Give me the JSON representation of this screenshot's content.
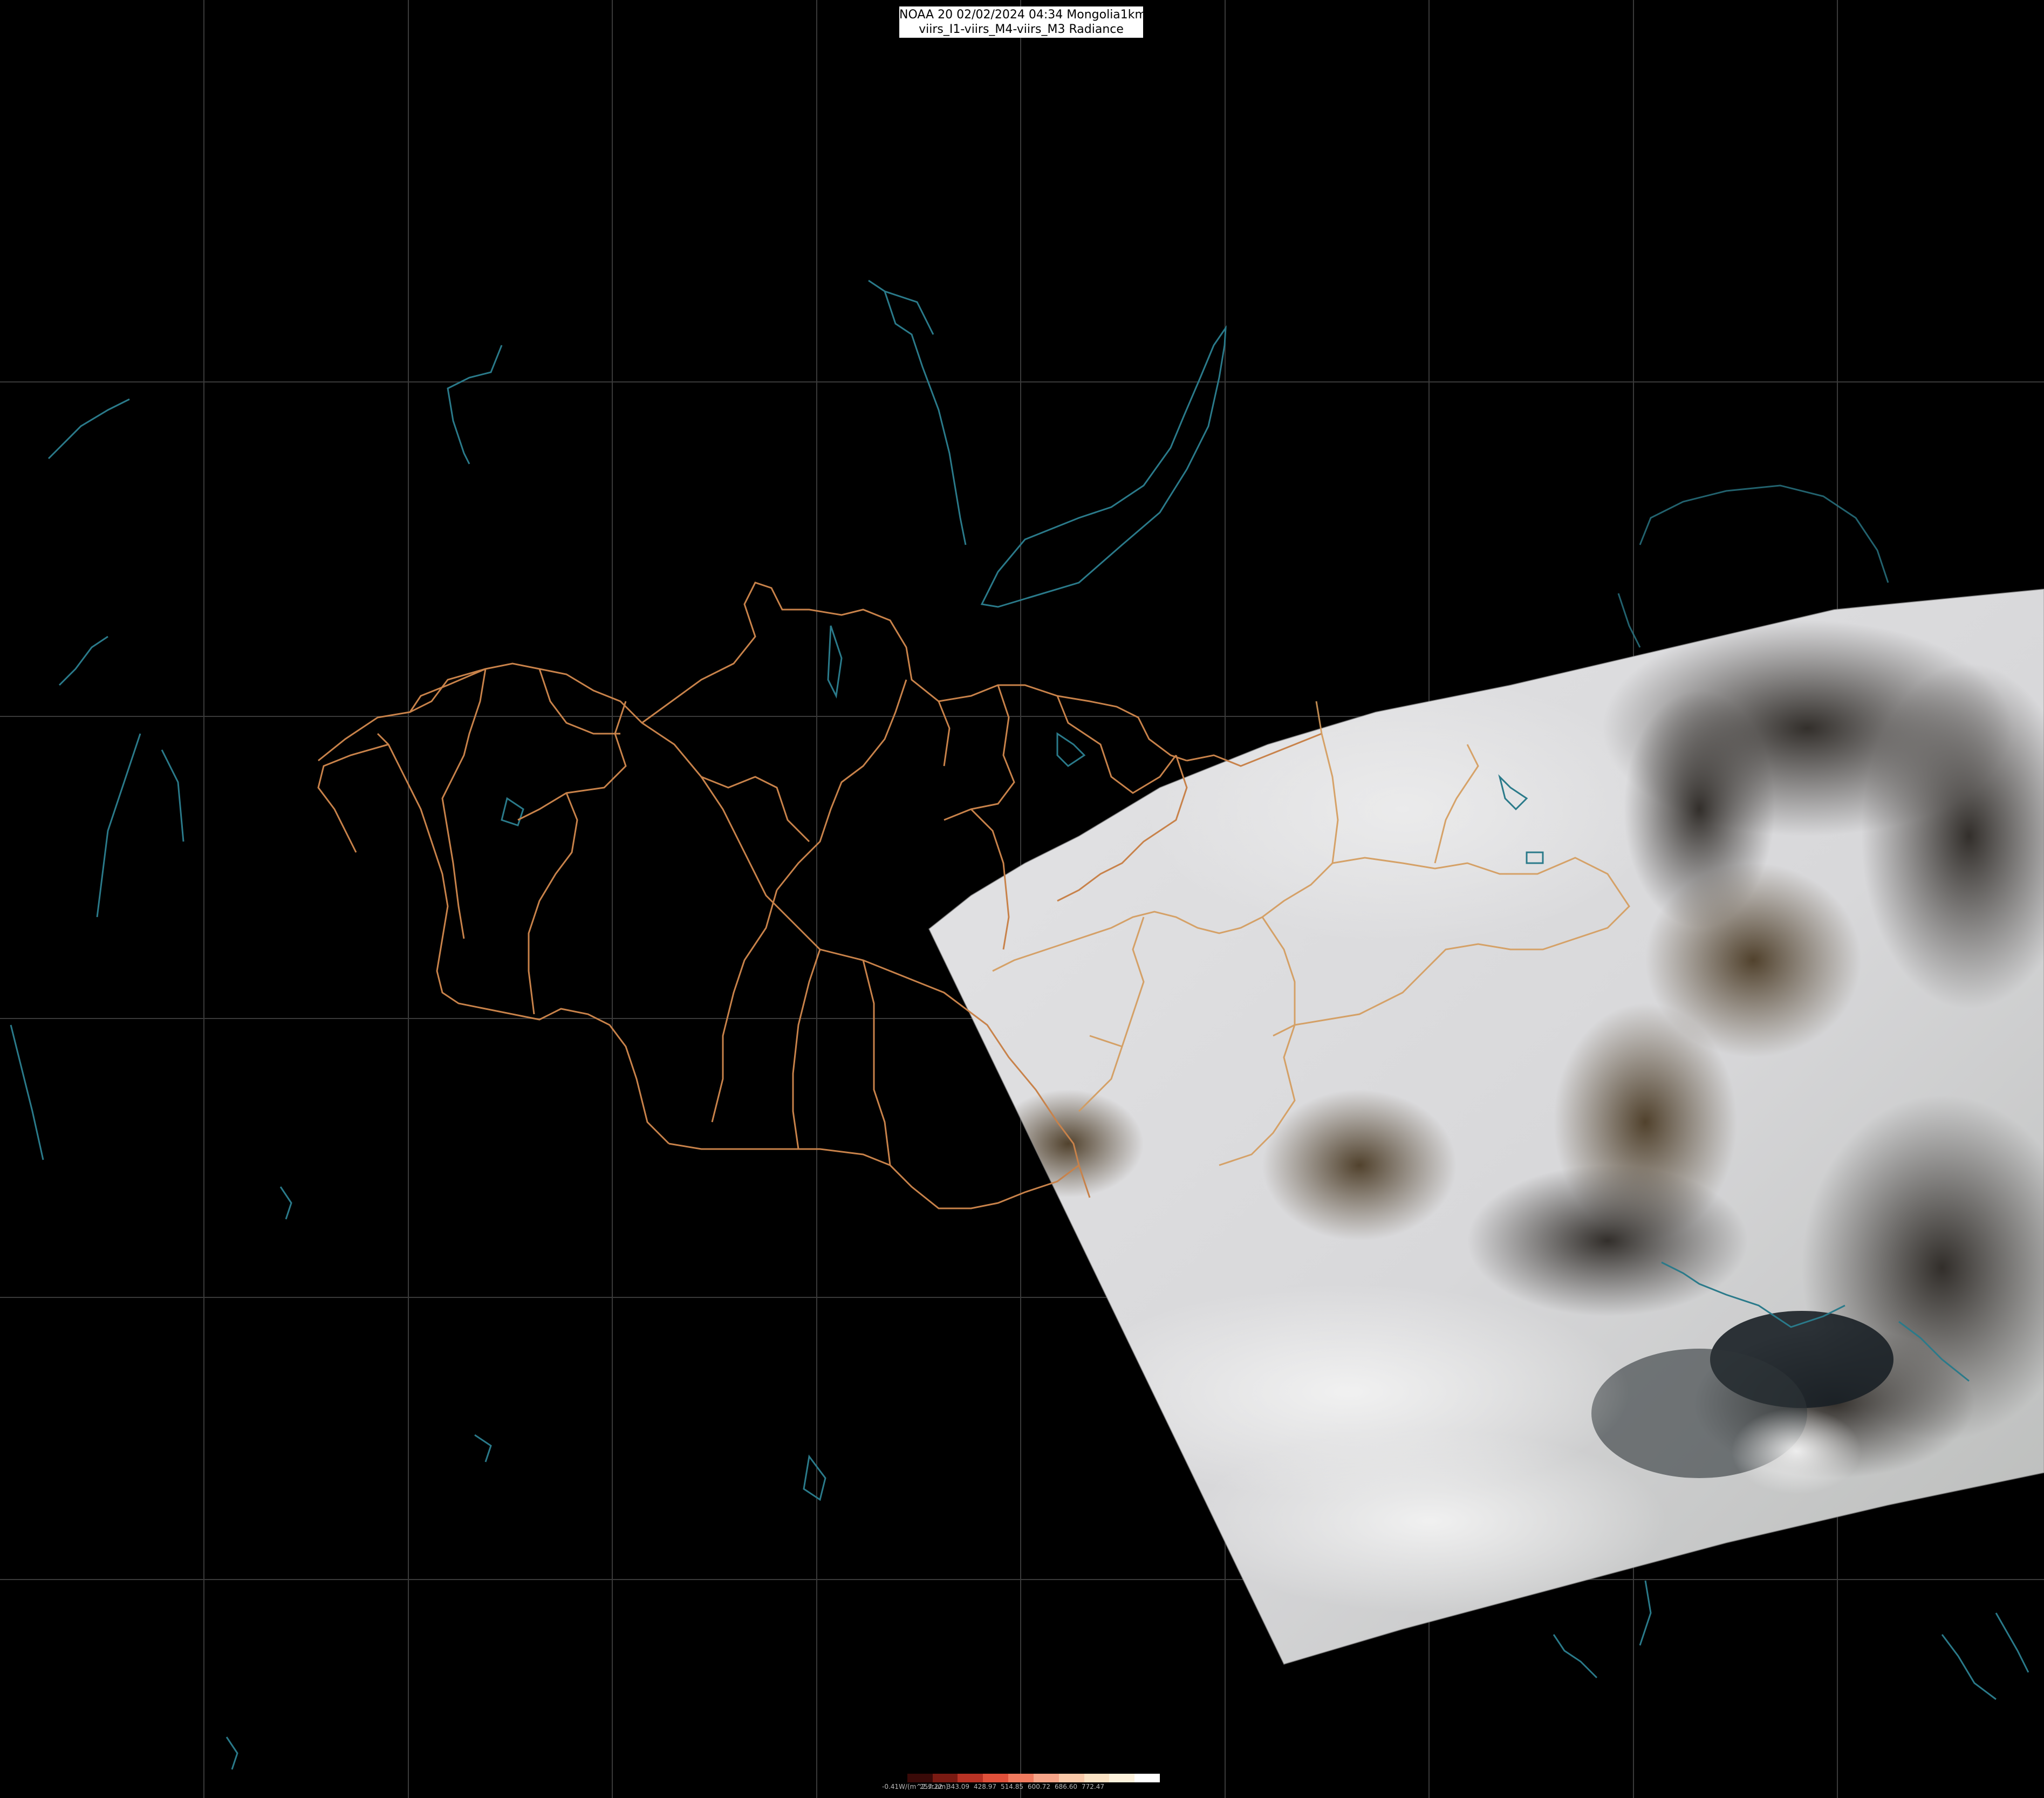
{
  "header": {
    "line1": "NOAA 20 02/02/2024 04:34 Mongolia1km",
    "line2": "viirs_I1-viirs_M4-viirs_M3 Radiance"
  },
  "legend": {
    "colors": [
      "#000000",
      "#3a0a08",
      "#7a1a12",
      "#b83224",
      "#e0503a",
      "#f07a5e",
      "#f6a488",
      "#f9c8a8",
      "#fbe2c4",
      "#fdf2dc",
      "#ffffff"
    ],
    "labels": [
      "-0.41W/(m^2.sr.um)",
      "257.22",
      "343.09",
      "428.97",
      "514.85",
      "600.72",
      "686.60",
      "772.47"
    ]
  },
  "map": {
    "background": "#000000",
    "gridline_color": "#3a3a3a",
    "border_color": "#c8824a",
    "coast_color": "#2a7a8a",
    "features": [
      "graticule",
      "mongolia-aimag-borders",
      "lakes-and-rivers",
      "satellite-swath"
    ]
  }
}
